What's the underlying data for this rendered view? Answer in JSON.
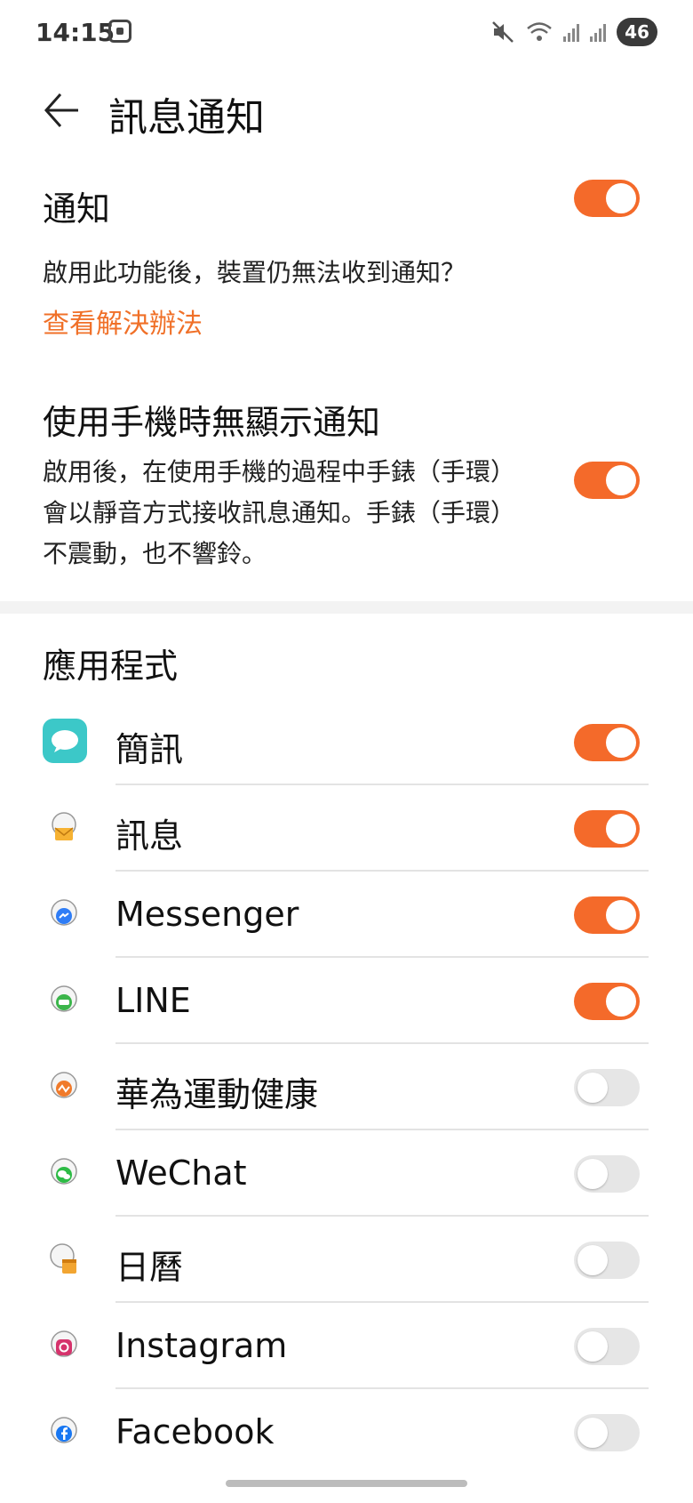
{
  "status_bar": {
    "time": "14:15",
    "battery": "46"
  },
  "header": {
    "title": "訊息通知"
  },
  "notification": {
    "title": "通知",
    "enabled": true,
    "help_text": "啟用此功能後，裝置仍無法收到通知？",
    "help_link": "查看解決辦法"
  },
  "silent_while_using": {
    "title": "使用手機時無顯示通知",
    "enabled": true,
    "description_lines": [
      "啟用後，在使用手機的過程中手錶（手環）",
      "會以靜音方式接收訊息通知。手錶（手環）",
      "不震動，也不響鈴。"
    ]
  },
  "apps_section": {
    "title": "應用程式",
    "items": [
      {
        "label": "簡訊",
        "enabled": true,
        "icon": "sms-icon"
      },
      {
        "label": "訊息",
        "enabled": true,
        "icon": "message-icon"
      },
      {
        "label": "Messenger",
        "enabled": true,
        "icon": "messenger-icon"
      },
      {
        "label": "LINE",
        "enabled": true,
        "icon": "line-icon"
      },
      {
        "label": "華為運動健康",
        "enabled": false,
        "icon": "huawei-health-icon"
      },
      {
        "label": "WeChat",
        "enabled": false,
        "icon": "wechat-icon"
      },
      {
        "label": "日曆",
        "enabled": false,
        "icon": "calendar-icon"
      },
      {
        "label": "Instagram",
        "enabled": false,
        "icon": "instagram-icon"
      },
      {
        "label": "Facebook",
        "enabled": false,
        "icon": "facebook-icon"
      }
    ]
  },
  "colors": {
    "accent": "#f46a2a",
    "toggle_off": "#e6e6e6",
    "link": "#f07028"
  }
}
